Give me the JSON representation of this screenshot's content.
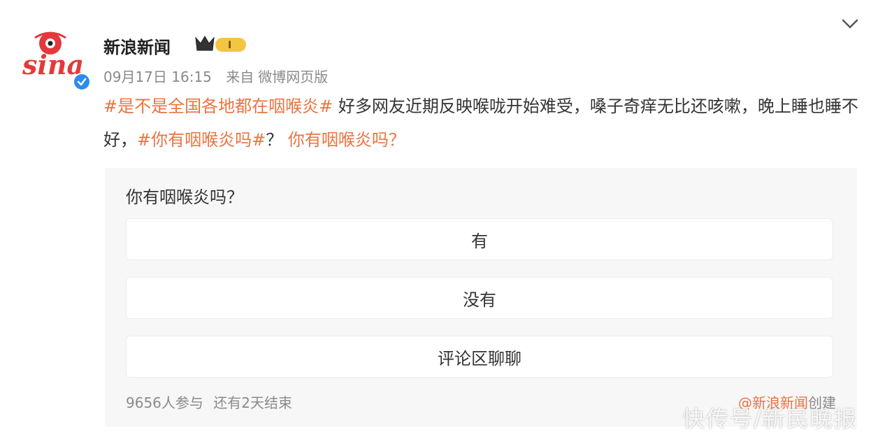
{
  "header": {
    "account_name": "新浪新闻",
    "level_badge": "I",
    "timestamp": "09月17日 16:15",
    "source_prefix": "来自",
    "source": "微博网页版",
    "avatar_text": "sina"
  },
  "post": {
    "tag1": "#是不是全国各地都在咽喉炎#",
    "text1": " 好多网友近期反映喉咙开始难受，嗓子奇痒无比还咳嗽，晚上睡也睡不好，",
    "tag2": "#你有咽喉炎吗#",
    "text2": "？ ",
    "poll_link": "你有咽喉炎吗？"
  },
  "poll": {
    "question": "你有咽喉炎吗？",
    "options": [
      "有",
      "没有",
      "评论区聊聊"
    ],
    "participants": "9656人参与",
    "remaining": "还有2天结束",
    "creator_link": "@新浪新闻",
    "creator_suffix": "创建"
  },
  "watermark": "快传号/新民晚报",
  "colors": {
    "tag": "#eb7340",
    "poll_bg": "#f7f7f7",
    "verify": "#2a8cf0"
  },
  "icons": [
    "sina-eye-logo",
    "verified-icon",
    "crown-badge-icon",
    "chevron-down-icon"
  ]
}
